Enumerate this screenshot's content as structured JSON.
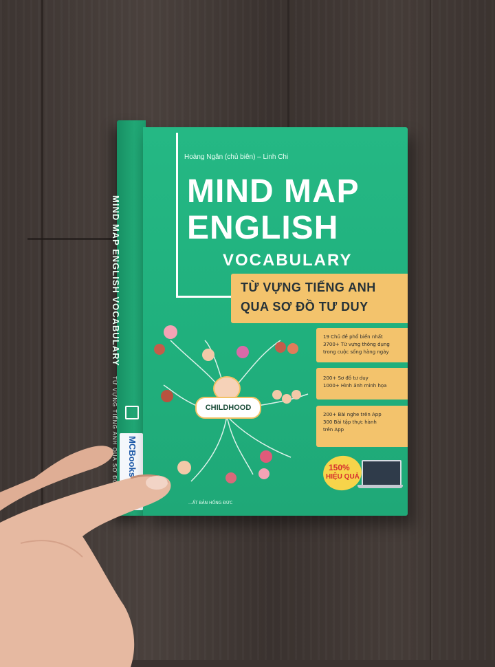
{
  "book": {
    "spine_title": "MIND MAP ENGLISH VOCABULARY",
    "spine_subtitle": "TỪ VỰNG TIẾNG ANH QUA SƠ ĐỒ TƯ DUY",
    "spine_publisher": "MCBooks",
    "authors": "Hoàng Ngân (chủ biên) – Linh Chi",
    "title_line1": "MIND MAP",
    "title_line2": "ENGLISH",
    "title_line3": "VOCABULARY",
    "subtitle_line1": "TỪ VỰNG TIẾNG ANH",
    "subtitle_line2": "QUA SƠ ĐỒ TƯ DUY",
    "mindmap_center": "CHILDHOOD",
    "features": [
      [
        "19 Chủ đề phổ biến nhất",
        "3700+ Từ vựng thông dụng",
        "trong cuộc sống hàng ngày"
      ],
      [
        "200+ Sơ đồ tư duy",
        "1000+ Hình ảnh minh họa"
      ],
      [
        "200+ Bài nghe trên App",
        "300 Bài tập thực hành",
        "trên App"
      ]
    ],
    "promo_percent": "150%",
    "promo_word": "HIỆU QUẢ",
    "publisher_line": "...ẤT BẢN HỒNG ĐỨC"
  },
  "colors": {
    "cover_green": "#22b27f",
    "accent_yellow": "#f3c36c",
    "floor": "#3b3330"
  }
}
